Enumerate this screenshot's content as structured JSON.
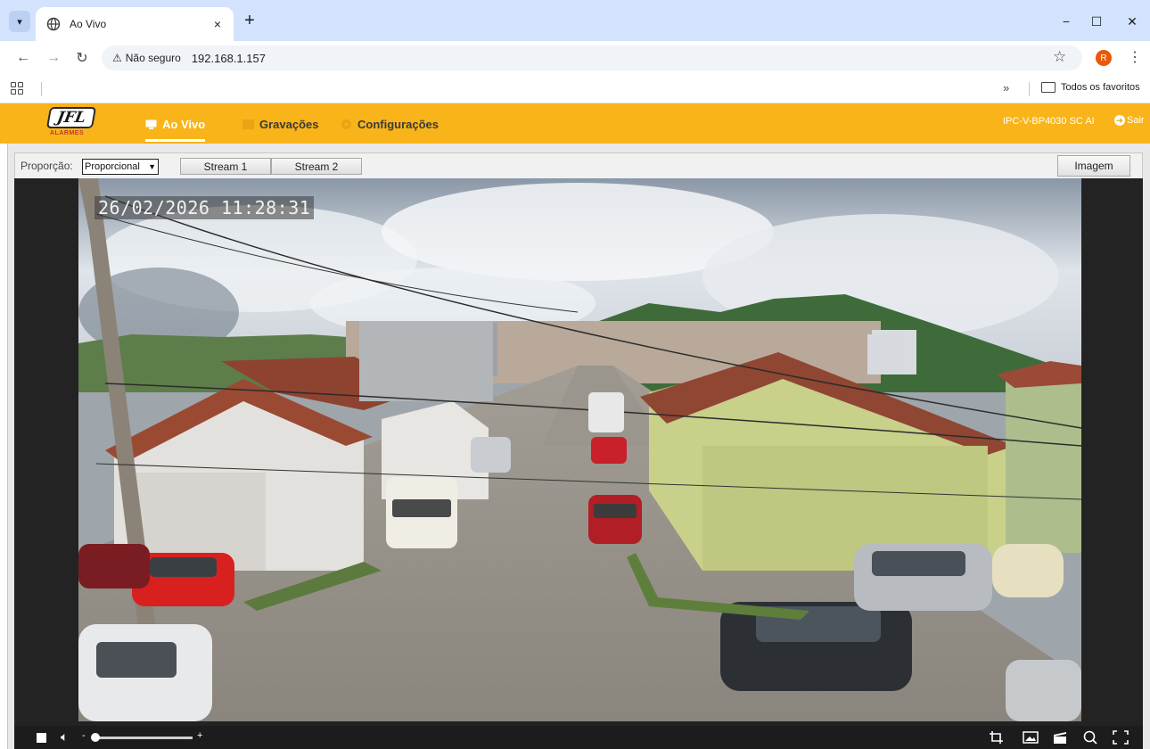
{
  "browser": {
    "tab_title": "Ao Vivo",
    "tab_close": "×",
    "new_tab": "+",
    "insecure_label": "Não seguro",
    "url": "192.168.1.157",
    "profile_initial": "R",
    "bookmarks_overflow": "»",
    "bookmarks_all": "Todos os favoritos",
    "window_controls": [
      "−",
      "☐",
      "✕"
    ]
  },
  "app": {
    "logo_text": "JFL",
    "logo_sub": "ALARMES",
    "menu": [
      {
        "label": "Ao Vivo",
        "active": true
      },
      {
        "label": "Gravações",
        "active": false
      },
      {
        "label": "Configurações",
        "active": false
      }
    ],
    "device_model": "IPC-V-BP4030 SC AI",
    "logout_label": "Sair"
  },
  "controls": {
    "ratio_label": "Proporção:",
    "ratio_value": "Proporcional",
    "streams": [
      "Stream 1",
      "Stream 2"
    ],
    "image_button": "Imagem"
  },
  "video": {
    "osd_timestamp": "26/02/2026 11:28:31"
  },
  "player_bar": {
    "volume_minus": "-",
    "volume_plus": "+",
    "volume_level": 0,
    "icons": [
      "stop-icon",
      "speaker-mute-icon",
      "crop-icon",
      "snapshot-icon",
      "record-icon",
      "zoom-icon",
      "fullscreen-icon"
    ]
  }
}
